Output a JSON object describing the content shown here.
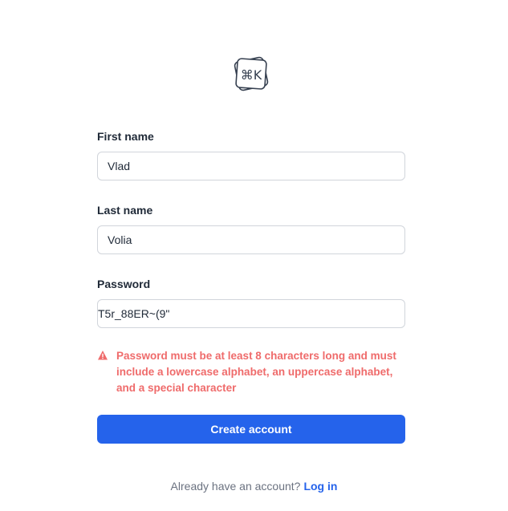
{
  "logo": {
    "icon": "command-k-logo",
    "text": "⌘K"
  },
  "form": {
    "first_name": {
      "label": "First name",
      "value": "Vlad"
    },
    "last_name": {
      "label": "Last name",
      "value": "Volia"
    },
    "password": {
      "label": "Password",
      "value": "T5r_88ER~(9\""
    },
    "error": {
      "icon": "warning-triangle-icon",
      "message": "Password must be at least 8 characters long and must include a lowercase alphabet, an uppercase alphabet, and a special character"
    },
    "submit_label": "Create account"
  },
  "footer": {
    "prompt": "Already have an account?",
    "link_label": "Log in"
  },
  "colors": {
    "primary": "#2563eb",
    "error": "#ef6b6b",
    "border": "#d1d5db"
  }
}
